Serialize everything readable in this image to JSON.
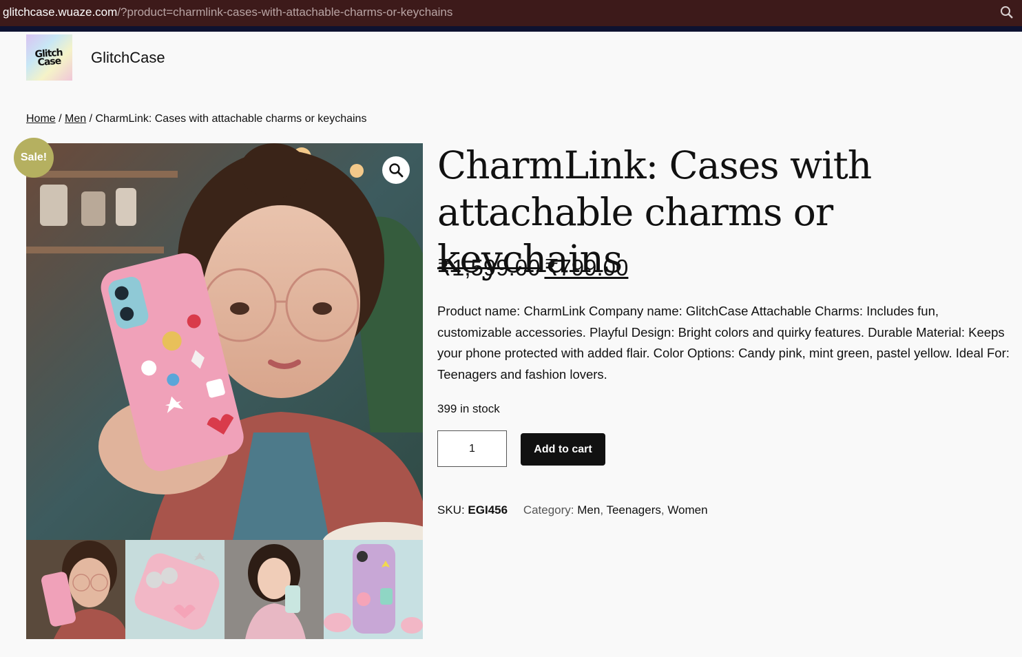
{
  "browser": {
    "url_host": "glitchcase.wuaze.com",
    "url_path": "/?product=charmlink-cases-with-attachable-charms-or-keychains"
  },
  "site": {
    "logo_text": "Glitch\nCase",
    "title": "GlitchCase"
  },
  "breadcrumb": {
    "home": "Home",
    "sep1": " / ",
    "category": "Men",
    "sep2": " / ",
    "current": "CharmLink: Cases with attachable charms or keychains"
  },
  "gallery": {
    "sale_badge": "Sale!",
    "thumbnails_count": 4
  },
  "product": {
    "title": "CharmLink: Cases with attachable charms or keychains",
    "price_regular": "₹1,599.00",
    "price_sale": "₹799.00",
    "description": "Product name: CharmLink Company name: GlitchCase Attachable Charms: Includes fun, customizable accessories. Playful Design: Bright colors and quirky features. Durable Material: Keeps your phone protected with added flair. Color Options: Candy pink, mint green, pastel yellow. Ideal For: Teenagers and fashion lovers.",
    "stock": "399 in stock",
    "quantity": "1",
    "add_to_cart": "Add to cart",
    "sku_label": "SKU:",
    "sku": "EGI456",
    "category_label": "Category:",
    "categories": [
      "Men",
      "Teenagers",
      "Women"
    ]
  },
  "colors": {
    "sale_badge": "#b5b060",
    "button": "#111111",
    "urlbar": "#3d1a1a"
  }
}
